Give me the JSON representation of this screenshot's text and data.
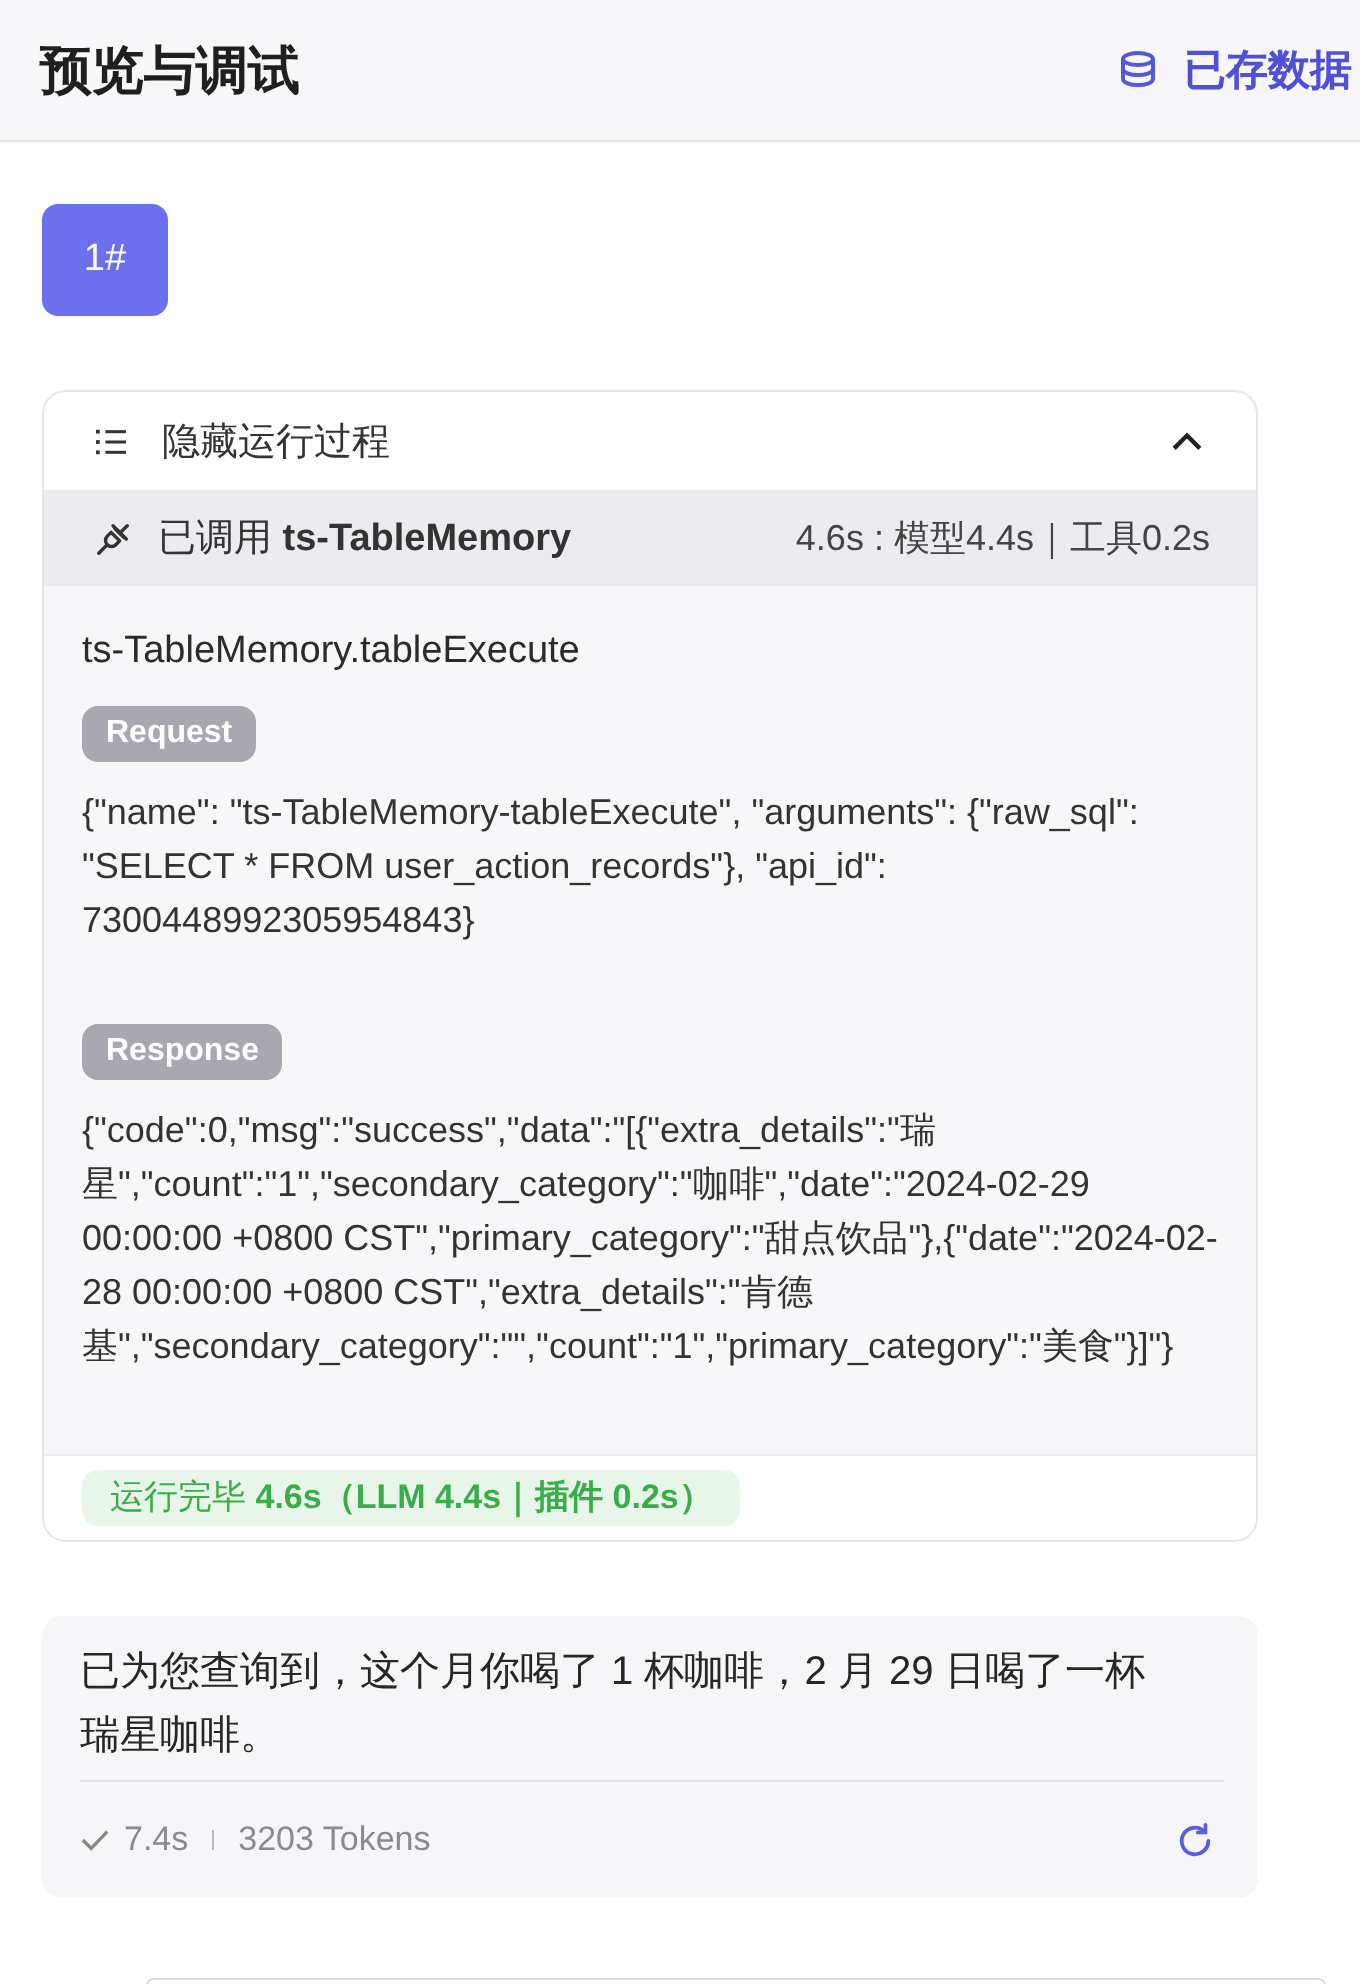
{
  "header": {
    "title": "预览与调试",
    "db_link": "已存数据"
  },
  "session_badge": "1#",
  "run_panel": {
    "toggle_label": "隐藏运行过程",
    "expanded": true,
    "tool_call": {
      "label": "已调用 **ts-TableMemory**",
      "timing": "4.6s : 模型4.4s｜工具0.2s"
    },
    "function_name": "ts-TableMemory.tableExecute",
    "request": {
      "tag": "Request",
      "body": "{\"name\": \"ts-TableMemory-tableExecute\", \"arguments\": {\"raw_sql\": \"SELECT * FROM user_action_records\"}, \"api_id\": 7300448992305954843}"
    },
    "response": {
      "tag": "Response",
      "body": "{\"code\":0,\"msg\":\"success\",\"data\":\"[{\"extra_details\":\"瑞星\",\"count\":\"1\",\"secondary_category\":\"咖啡\",\"date\":\"2024-02-29 00:00:00 +0800 CST\",\"primary_category\":\"甜点饮品\"},{\"date\":\"2024-02-28 00:00:00 +0800 CST\",\"extra_details\":\"肯德基\",\"secondary_category\":\"\",\"count\":\"1\",\"primary_category\":\"美食\"}]\"}"
    },
    "status": "运行完毕 **4.6s（LLM 4.4s｜插件 0.2s）**"
  },
  "answer": {
    "text": "已为您查询到，这个月你喝了 1 杯咖啡，2 月 29 日喝了一杯瑞星咖啡。",
    "duration": "7.4s",
    "tokens": "3203 Tokens"
  }
}
